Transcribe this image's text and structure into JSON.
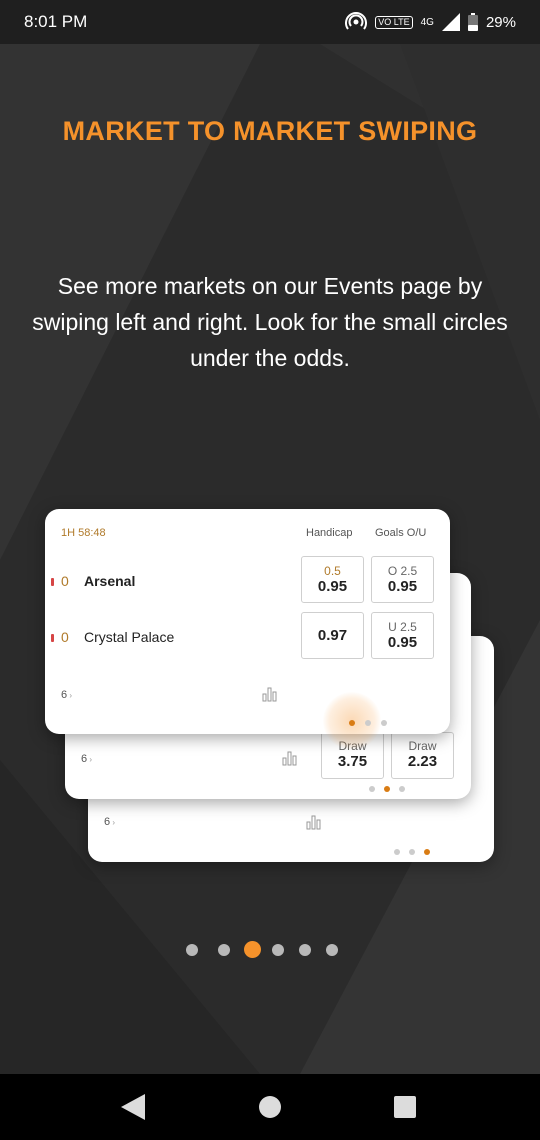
{
  "status_bar": {
    "time": "8:01 PM",
    "network": "4G",
    "volte": "VO LTE",
    "battery": "29%"
  },
  "title": "MARKET TO MARKET SWIPING",
  "description": "See more markets on our Events page by swiping left and right. Look for the small circles under the odds.",
  "front_card": {
    "match_time": "1H 58:48",
    "col_handicap": "Handicap",
    "col_goals": "Goals O/U",
    "rows": [
      {
        "score": "0",
        "team": "Arsenal",
        "handicap_line": "0.5",
        "handicap_odds": "0.95",
        "goals_line": "O 2.5",
        "goals_odds": "0.95"
      },
      {
        "score": "0",
        "team": "Crystal Palace",
        "handicap_line": "",
        "handicap_odds": "0.97",
        "goals_line": "U 2.5",
        "goals_odds": "0.95"
      }
    ],
    "more_markets": "6"
  },
  "middle_card": {
    "more_markets": "6",
    "draw_label_1": "Draw",
    "draw_odds_1": "3.75",
    "draw_label_2": "Draw",
    "draw_odds_2": "2.23"
  },
  "back_card": {
    "more_markets": "6"
  },
  "pager": {
    "total": 6,
    "active_index": 2
  },
  "colors": {
    "accent": "#f5922b",
    "background": "#2a2a2a",
    "card": "#ffffff"
  },
  "icons": {
    "status": [
      "hotspot-icon",
      "volte-icon",
      "signal-icon",
      "battery-icon"
    ],
    "card": [
      "stats-icon",
      "chevron-right-icon"
    ],
    "nav": [
      "back-icon",
      "home-icon",
      "recents-icon"
    ]
  }
}
